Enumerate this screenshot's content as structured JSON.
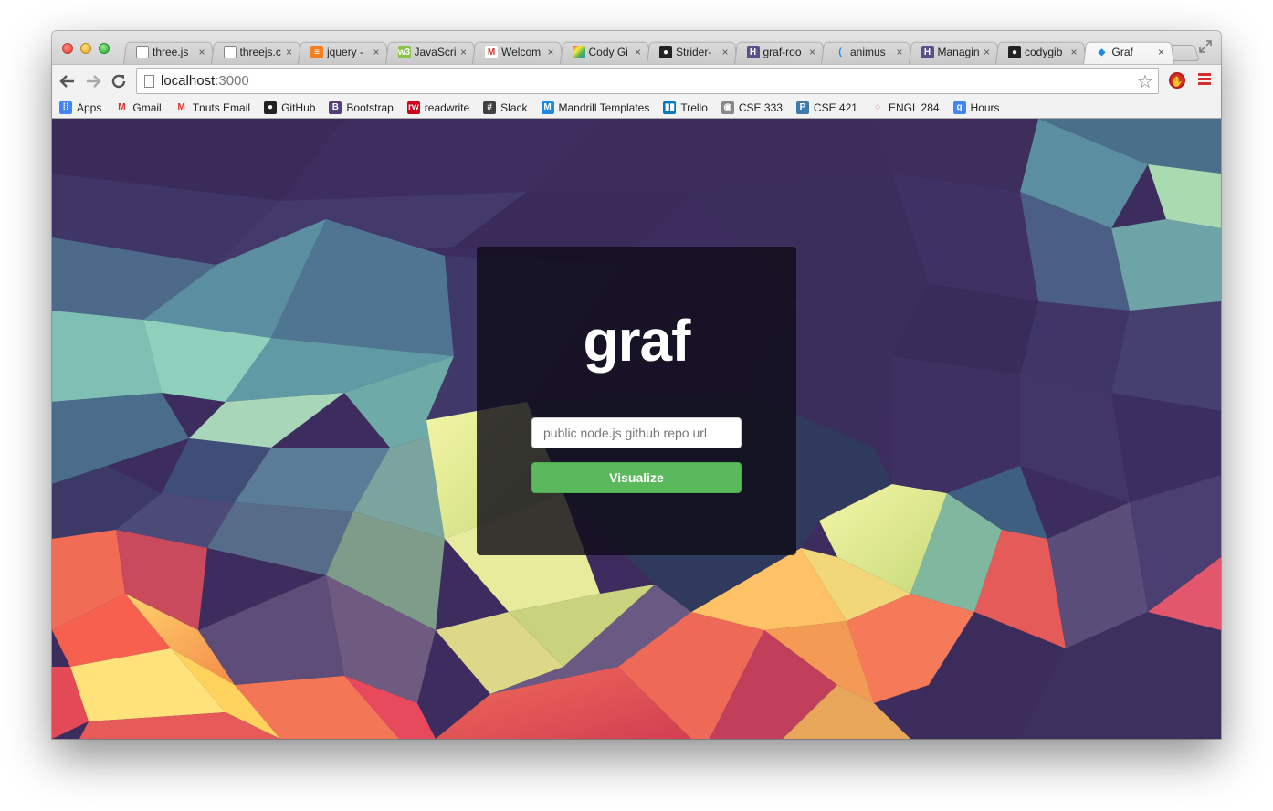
{
  "browser": {
    "tabs": [
      {
        "title": "three.js",
        "icon": "page-icon",
        "active": false
      },
      {
        "title": "threejs.c",
        "icon": "page-icon",
        "active": false
      },
      {
        "title": "jquery -",
        "icon": "stackoverflow-icon",
        "active": false
      },
      {
        "title": "JavaScri",
        "icon": "javascript-icon",
        "active": false
      },
      {
        "title": "Welcom",
        "icon": "gmail-icon",
        "active": false
      },
      {
        "title": "Cody Gi",
        "icon": "pinwheel-icon",
        "active": false
      },
      {
        "title": "Strider-",
        "icon": "github-icon",
        "active": false
      },
      {
        "title": "graf-roo",
        "icon": "heroku-icon",
        "active": false
      },
      {
        "title": "animus",
        "icon": "spinner-icon",
        "active": false
      },
      {
        "title": "Managin",
        "icon": "heroku-icon",
        "active": false
      },
      {
        "title": "codygib",
        "icon": "github-icon",
        "active": false
      },
      {
        "title": "Graf",
        "icon": "diamond-icon",
        "active": true
      }
    ],
    "tab_close_glyph": "×",
    "url_host": "localhost",
    "url_port": ":3000",
    "bookmarks": [
      {
        "label": "Apps",
        "icon": "apps-grid-icon",
        "color": "#4285f4"
      },
      {
        "label": "Gmail",
        "icon": "gmail-icon",
        "color": "#d93025"
      },
      {
        "label": "Tnuts Email",
        "icon": "gmail-icon",
        "color": "#d93025"
      },
      {
        "label": "GitHub",
        "icon": "github-icon",
        "color": "#222222"
      },
      {
        "label": "Bootstrap",
        "icon": "bootstrap-icon",
        "color": "#563d7c"
      },
      {
        "label": "readwrite",
        "icon": "readwrite-icon",
        "color": "#d0021b"
      },
      {
        "label": "Slack",
        "icon": "slack-icon",
        "color": "#3f3f3f"
      },
      {
        "label": "Mandrill Templates",
        "icon": "mandrill-icon",
        "color": "#1e88e5"
      },
      {
        "label": "Trello",
        "icon": "trello-icon",
        "color": "#0079bf"
      },
      {
        "label": "CSE 333",
        "icon": "cse-icon",
        "color": "#888888"
      },
      {
        "label": "CSE 421",
        "icon": "piazza-icon",
        "color": "#3e7aab"
      },
      {
        "label": "ENGL 284",
        "icon": "engl-icon",
        "color": "#e53935"
      },
      {
        "label": "Hours",
        "icon": "google-icon",
        "color": "#4285f4"
      }
    ]
  },
  "page": {
    "logo": "graf",
    "input_placeholder": "public node.js github repo url",
    "button_label": "Visualize",
    "accent_color": "#5cb85c"
  }
}
